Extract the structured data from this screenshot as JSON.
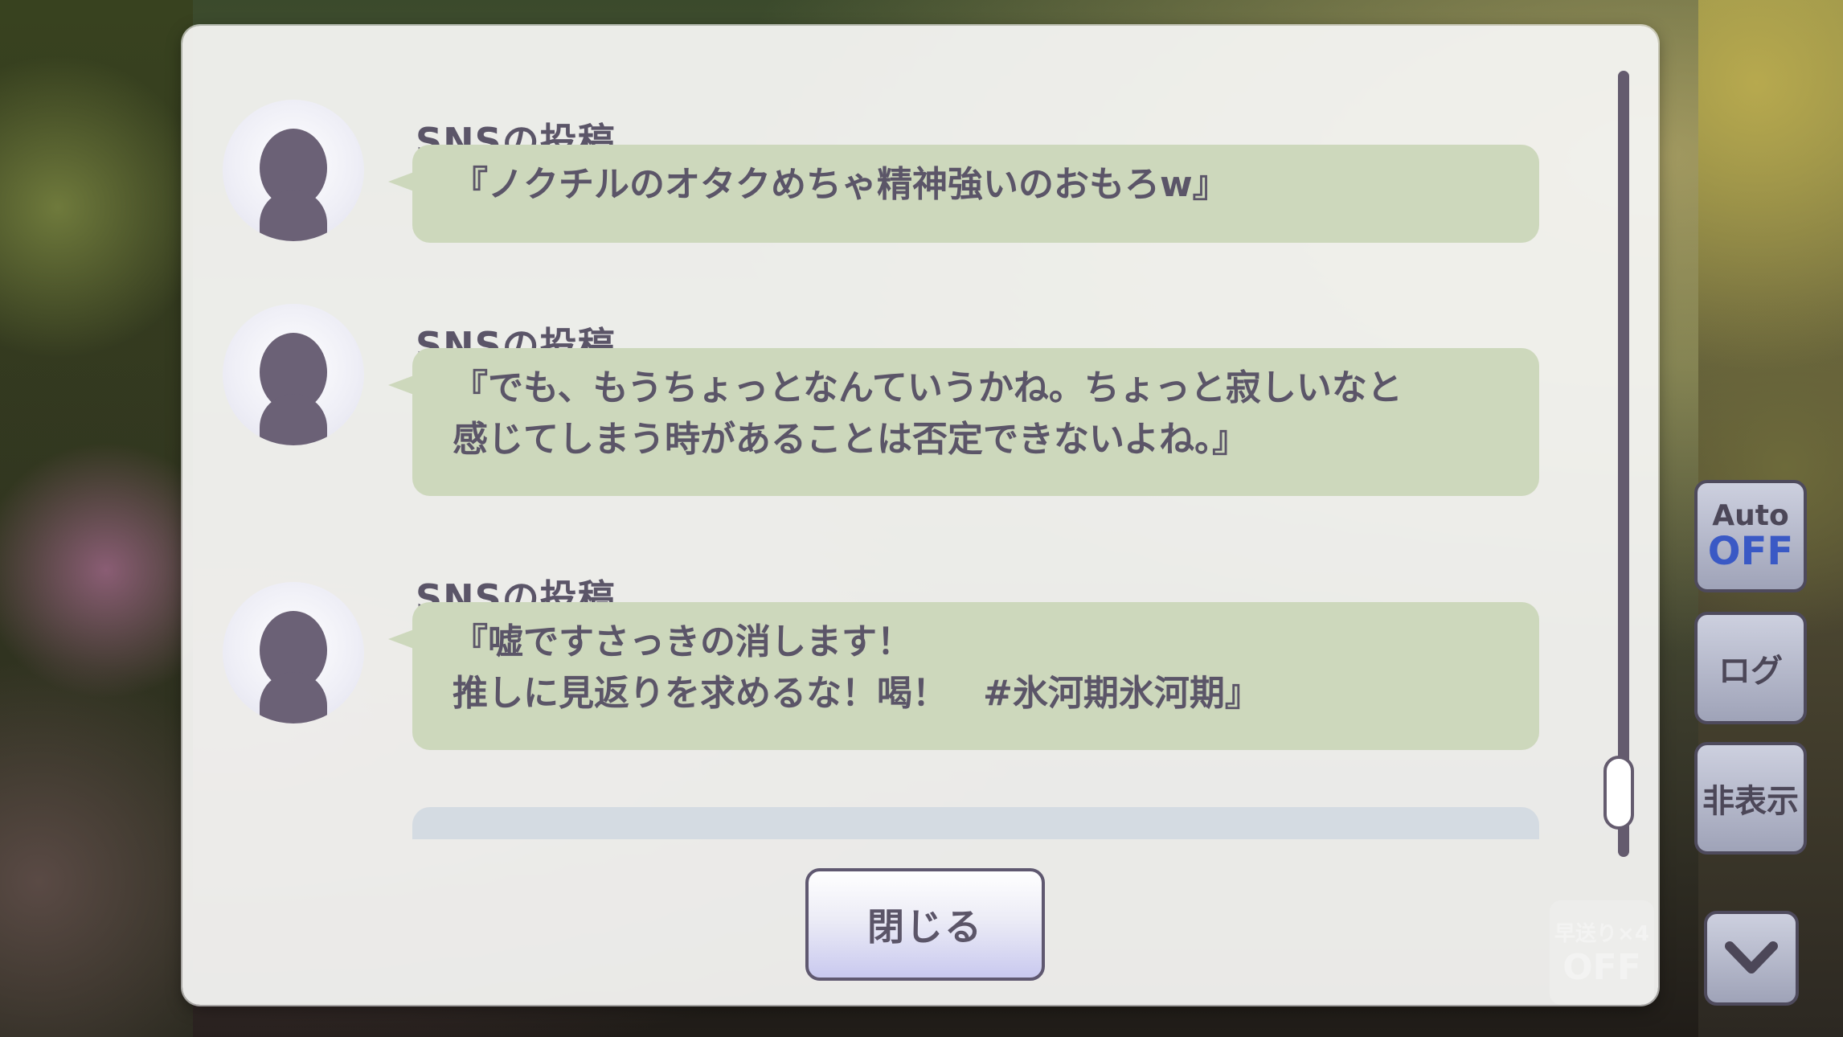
{
  "log": {
    "entries": [
      {
        "speaker": "SNSの投稿",
        "text": "『ノクチルのオタクめちゃ精神強いのおもろw』"
      },
      {
        "speaker": "SNSの投稿",
        "text": "『でも、もうちょっとなんていうかね。ちょっと寂しいなと\n感じてしまう時があることは否定できないよね。』"
      },
      {
        "speaker": "SNSの投稿",
        "text": "『嘘ですさっきの消します！\n推しに見返りを求めるな！喝！　#氷河期氷河期』"
      }
    ]
  },
  "close_button": {
    "label": "閉じる"
  },
  "side_panel": {
    "auto": {
      "label": "Auto",
      "state": "OFF"
    },
    "log_label": "ログ",
    "hide_label": "非表示",
    "scroll_down_icon": "chevron-down-icon"
  },
  "fast_forward": {
    "label": "早送り×4",
    "state": "OFF"
  },
  "colors": {
    "bubble": "#cdd8bc",
    "text": "#5b5568",
    "auto_off": "#3a59c5",
    "panel_bg": "#f4f4f2"
  }
}
